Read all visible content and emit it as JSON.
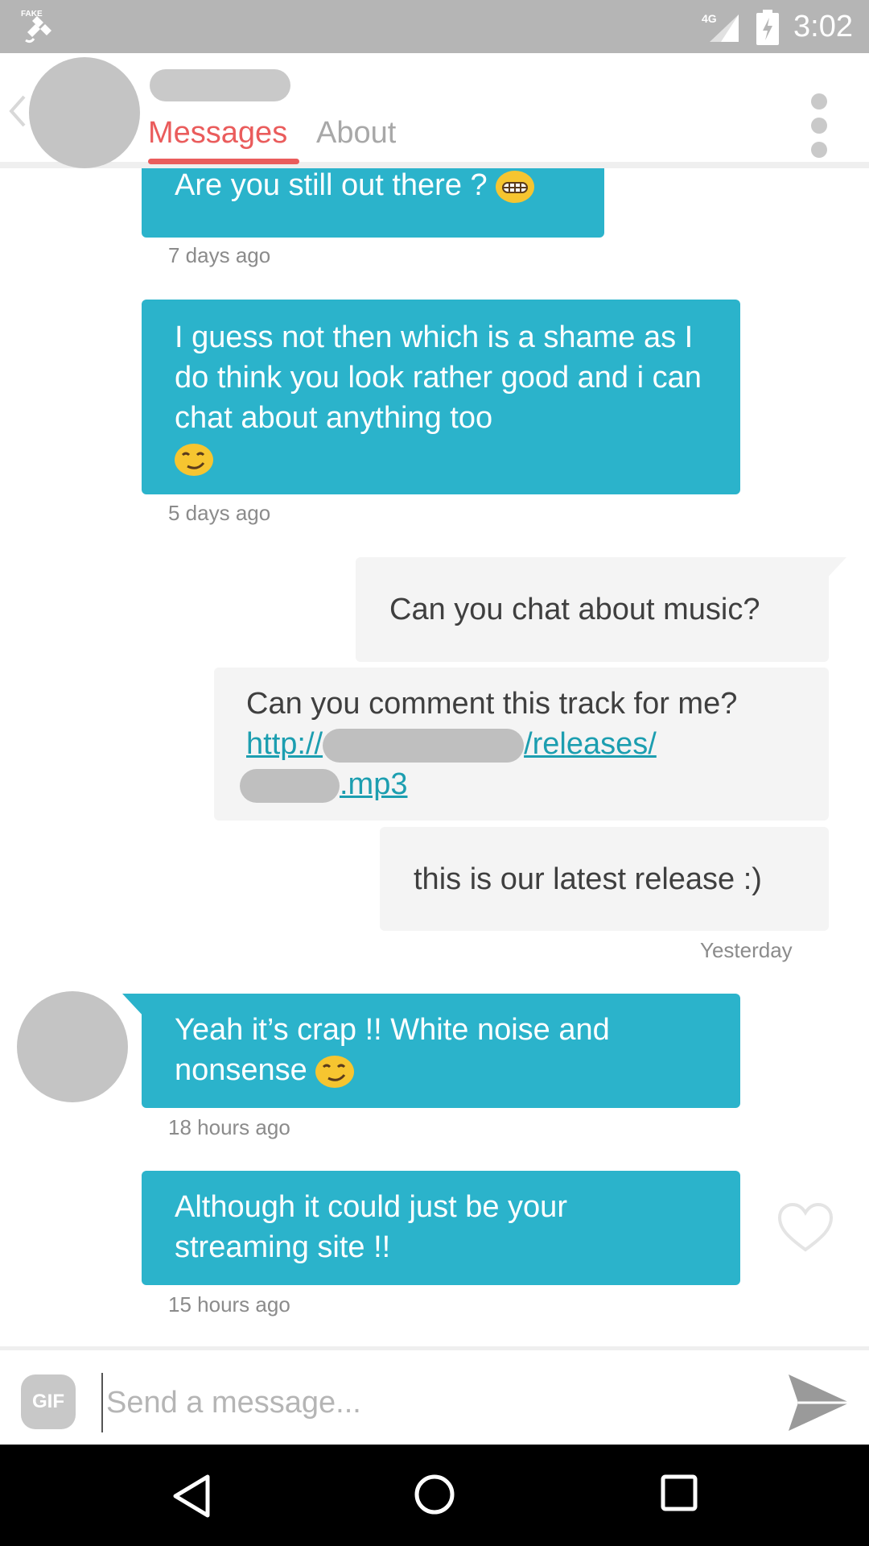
{
  "status_bar": {
    "time": "3:02",
    "network": "4G",
    "left_icon": "fake-gps-icon"
  },
  "header": {
    "tabs": [
      {
        "label": "Messages",
        "active": true
      },
      {
        "label": "About",
        "active": false
      }
    ],
    "accent_color": "#ea5c5c"
  },
  "messages": [
    {
      "direction": "in",
      "text": "Are you still out there ?",
      "emoji": "grinning-face-icon",
      "time": "7 days ago"
    },
    {
      "direction": "in",
      "text": "I guess not then which is a shame as I do think you look rather good and i can chat about anything too",
      "emoji": "smirking-face-icon",
      "time": "5 days ago"
    },
    {
      "direction": "out",
      "text": "Can you chat about music?"
    },
    {
      "direction": "out",
      "text": "Can you comment this track for me?",
      "link_start": "http://",
      "link_mid": "/releases/",
      "link_end": ".mp3"
    },
    {
      "direction": "out",
      "text": "this is our latest release :)",
      "time": "Yesterday"
    },
    {
      "direction": "in",
      "text": "Yeah it’s crap !! White noise and nonsense",
      "emoji": "smirking-face-icon",
      "time": "18 hours ago"
    },
    {
      "direction": "in",
      "text": "Although it could just be your streaming site !!",
      "time": "15 hours ago"
    }
  ],
  "composer": {
    "gif_label": "GIF",
    "placeholder": "Send a message..."
  },
  "colors": {
    "incoming_bubble": "#2bb3cb",
    "outgoing_bubble": "#f4f4f4",
    "link": "#1c9eb0"
  }
}
